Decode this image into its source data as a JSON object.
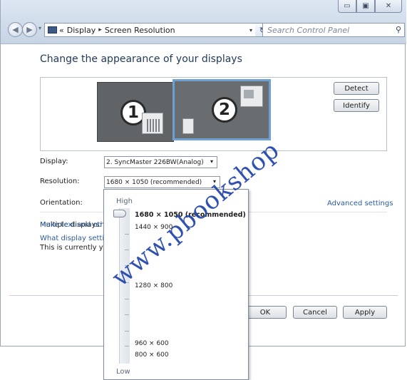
{
  "window": {
    "minimize_symbol": "▭",
    "maximize_symbol": "▣",
    "close_symbol": "✕"
  },
  "address": {
    "overflow": "«",
    "crumb1": "Display",
    "crumb2": "Screen Resolution",
    "separator": "▸",
    "dropdown_symbol": "▾",
    "refresh_symbol": "↻",
    "search_placeholder": "Search Control Panel",
    "search_symbol": "⚲"
  },
  "main": {
    "title": "Change the appearance of your displays",
    "monitor1_number": "1",
    "monitor2_number": "2",
    "detect_label": "Detect",
    "identify_label": "Identify",
    "display_label": "Display:",
    "display_value": "2. SyncMaster 226BW(Analog)",
    "resolution_label": "Resolution:",
    "resolution_value": "1680 × 1050 (recommended)",
    "orientation_label": "Orientation:",
    "multiple_label": "Multiple displays:",
    "current_text": "This is currently you",
    "advanced_link": "Advanced settings",
    "text_link": "Make text and other",
    "which_link": "What display setting",
    "ok_label": "OK",
    "cancel_label": "Cancel",
    "apply_label": "Apply",
    "combo_arrow": "▾"
  },
  "dropdown": {
    "high_label": "High",
    "low_label": "Low",
    "items": [
      "1680 × 1050 (recommended)",
      "1440 × 900",
      "1280 × 800",
      "960 × 600",
      "800 × 600"
    ],
    "selected_index": 0
  },
  "watermark": "www.pbookshop"
}
